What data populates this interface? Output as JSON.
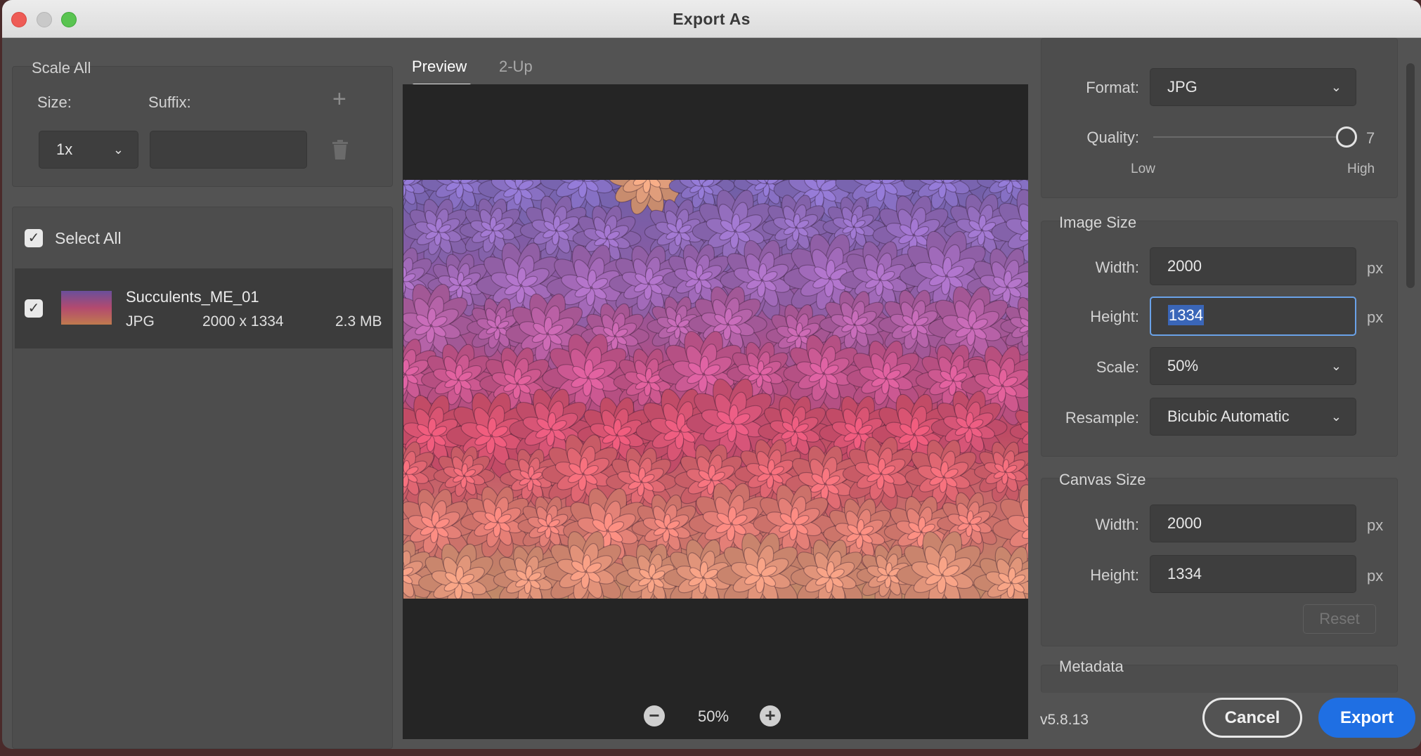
{
  "window": {
    "title": "Export As"
  },
  "left": {
    "scale_all": {
      "title": "Scale All",
      "size_label": "Size:",
      "suffix_label": "Suffix:",
      "size_value": "1x",
      "suffix_value": ""
    },
    "select_all": {
      "label": "Select All",
      "checked": true
    },
    "files": [
      {
        "name": "Succulents_ME_01",
        "format": "JPG",
        "dimensions": "2000 x 1334",
        "size": "2.3 MB",
        "checked": true
      }
    ]
  },
  "preview": {
    "tabs": [
      {
        "label": "Preview",
        "active": true
      },
      {
        "label": "2-Up",
        "active": false
      }
    ],
    "zoom": "50%"
  },
  "settings": {
    "file_settings": {
      "format_label": "Format:",
      "format_value": "JPG",
      "quality_label": "Quality:",
      "quality_value": "7",
      "low_label": "Low",
      "high_label": "High"
    },
    "image_size": {
      "title": "Image Size",
      "width_label": "Width:",
      "width_value": "2000",
      "height_label": "Height:",
      "height_value": "1334",
      "scale_label": "Scale:",
      "scale_value": "50%",
      "resample_label": "Resample:",
      "resample_value": "Bicubic Automatic",
      "unit": "px"
    },
    "canvas_size": {
      "title": "Canvas Size",
      "width_label": "Width:",
      "width_value": "2000",
      "height_label": "Height:",
      "height_value": "1334",
      "unit": "px",
      "reset_label": "Reset"
    },
    "metadata": {
      "title": "Metadata"
    }
  },
  "footer": {
    "version": "v5.8.13",
    "cancel_label": "Cancel",
    "export_label": "Export"
  },
  "colors": {
    "accent": "#1f6fe3",
    "panel": "#4d4d4d",
    "field": "#3e3e3e"
  }
}
